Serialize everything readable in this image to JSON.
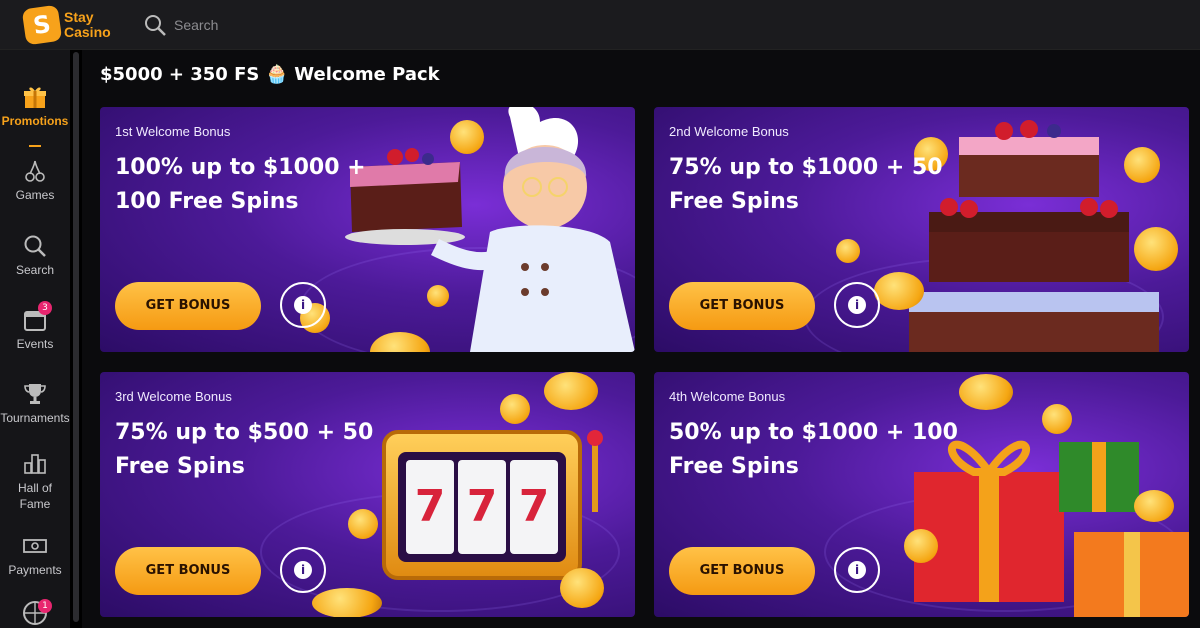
{
  "brand": {
    "name_line1": "Stay",
    "name_line2": "Casino",
    "accent": "#f7a21b"
  },
  "search": {
    "label": "Search"
  },
  "sidebar": {
    "items": [
      {
        "label": "Promotions",
        "icon": "gift-icon",
        "active": true
      },
      {
        "label": "Games",
        "icon": "cherries-icon"
      },
      {
        "label": "Search",
        "icon": "search-icon"
      },
      {
        "label": "Events",
        "icon": "calendar-icon",
        "badge": "3"
      },
      {
        "label": "Tournaments",
        "icon": "trophy-icon"
      },
      {
        "label": "Hall of Fame",
        "icon": "podium-icon"
      },
      {
        "label": "Payments",
        "icon": "cash-icon"
      },
      {
        "label": "",
        "icon": "wheel-icon",
        "badge": "1"
      }
    ]
  },
  "pack": {
    "title": "$5000 + 350 FS 🧁 Welcome Pack"
  },
  "cards": [
    {
      "subtitle": "1st Welcome Bonus",
      "title": "100% up to $1000 + 100 Free Spins",
      "button": "GET BONUS",
      "info": "i",
      "art": "chef-with-cake"
    },
    {
      "subtitle": "2nd Welcome Bonus",
      "title": "75% up to $1000 + 50 Free Spins",
      "button": "GET BONUS",
      "info": "i",
      "art": "layered-cake"
    },
    {
      "subtitle": "3rd Welcome Bonus",
      "title": "75% up to $500 + 50 Free Spins",
      "button": "GET BONUS",
      "info": "i",
      "art": "slot-machine-777"
    },
    {
      "subtitle": "4th Welcome Bonus",
      "title": "50% up to $1000 + 100 Free Spins",
      "button": "GET BONUS",
      "info": "i",
      "art": "gift-boxes"
    }
  ],
  "slot": {
    "reels": [
      "7",
      "7",
      "7"
    ]
  }
}
